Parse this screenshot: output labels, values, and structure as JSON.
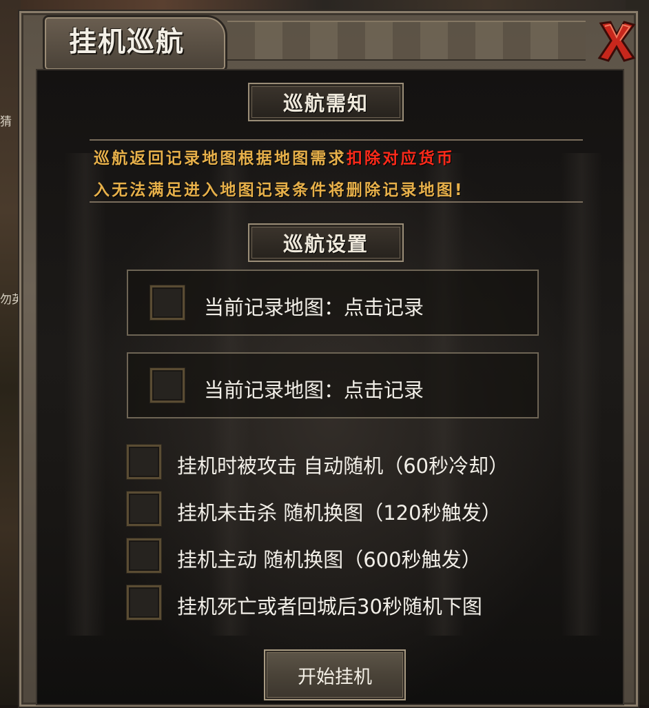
{
  "window": {
    "title": "挂机巡航",
    "close_icon": "close-x-icon"
  },
  "world_edges": {
    "left_text_1": "猜",
    "left_text_2": "勿英"
  },
  "notice_section": {
    "header": "巡航需知",
    "line1_normal": "巡航返回记录地图根据地图需求",
    "line1_highlight": "扣除对应货币",
    "line2": "入无法满足进入地图记录条件将删除记录地图!",
    "colors": {
      "normal": "#e7b04a",
      "highlight": "#ff2a1a"
    }
  },
  "settings_section": {
    "header": "巡航设置",
    "records": [
      {
        "label": "当前记录地图：点击记录",
        "checked": false
      },
      {
        "label": "当前记录地图：点击记录",
        "checked": false
      }
    ],
    "options": [
      {
        "label": "挂机时被攻击 自动随机（60秒冷却）",
        "checked": false
      },
      {
        "label": "挂机未击杀 随机换图（120秒触发）",
        "checked": false
      },
      {
        "label": "挂机主动 随机换图（600秒触发）",
        "checked": false
      },
      {
        "label": "挂机死亡或者回城后30秒随机下图",
        "checked": false
      }
    ]
  },
  "start_button": {
    "label": "开始挂机"
  }
}
